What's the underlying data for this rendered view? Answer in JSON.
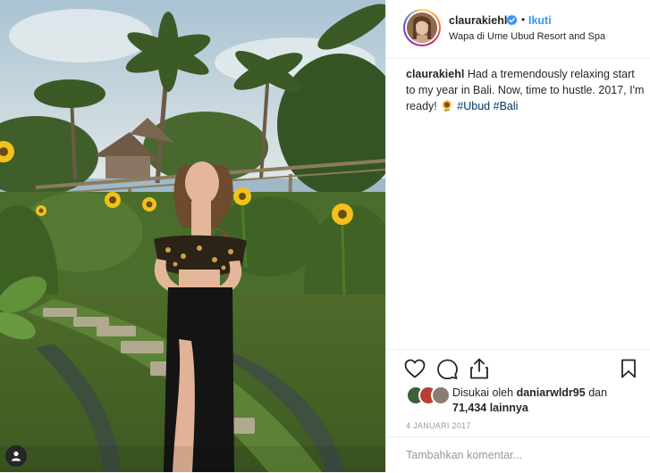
{
  "post": {
    "username": "claurakiehl",
    "separator": "•",
    "follow_label": "Ikuti",
    "location": "Wapa di Ume Ubud Resort and Spa"
  },
  "caption": {
    "username": "claurakiehl",
    "text": "Had a tremendously relaxing start to my year in Bali. Now, time to hustle. 2017, I'm ready!",
    "emoji": "🌻",
    "hashtags": [
      "#Ubud",
      "#Bali"
    ]
  },
  "likes": {
    "prefix": "Disukai oleh",
    "liker": "daniarwldr95",
    "connector": "dan",
    "others": "71,434 lainnya"
  },
  "date": "4 JANUARI 2017",
  "comment": {
    "placeholder": "Tambahkan komentar..."
  },
  "icons": {
    "like": "heart-icon",
    "comment": "comment-bubble-icon",
    "share": "share-icon",
    "save": "bookmark-icon",
    "verified": "verified-badge-icon",
    "profile": "user-icon"
  },
  "colors": {
    "link": "#3897f0",
    "hashtag": "#003569",
    "verified": "#3897f0",
    "muted": "#999999",
    "text": "#262626"
  }
}
